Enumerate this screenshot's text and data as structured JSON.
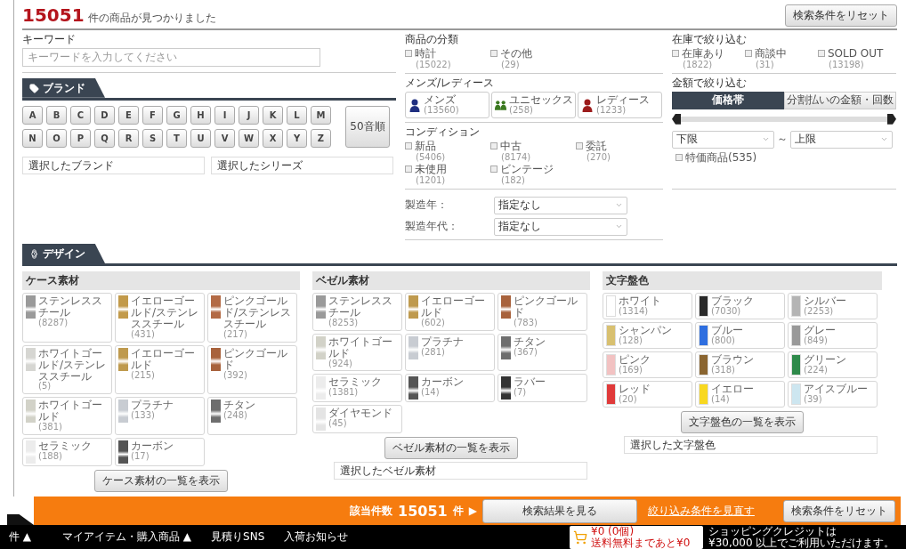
{
  "header": {
    "count": "15051",
    "text": "件の商品が見つかりました",
    "reset_button": "検索条件をリセット"
  },
  "keyword": {
    "label": "キーワード",
    "placeholder": "キーワードを入力してください"
  },
  "brand": {
    "tab": "ブランド",
    "letters": [
      "A",
      "B",
      "C",
      "D",
      "E",
      "F",
      "G",
      "H",
      "I",
      "J",
      "K",
      "L",
      "M",
      "N",
      "O",
      "P",
      "Q",
      "R",
      "S",
      "T",
      "U",
      "V",
      "W",
      "X",
      "Y",
      "Z"
    ],
    "kana_button": "50音順",
    "selected_brand": "選択したブランド",
    "selected_series": "選択したシリーズ"
  },
  "category": {
    "title": "商品の分類",
    "options": [
      {
        "label": "時計",
        "count": "(15022)",
        "checked": false
      },
      {
        "label": "その他",
        "count": "(29)",
        "checked": false
      }
    ]
  },
  "gender": {
    "title": "メンズ/レディース",
    "options": [
      {
        "label": "メンズ",
        "count": "(13560)",
        "color": "#1f2f80",
        "selected": false,
        "kind": "single"
      },
      {
        "label": "ユニセックス",
        "count": "(258)",
        "color": "#3d7a22",
        "selected": false,
        "kind": "pair"
      },
      {
        "label": "レディース",
        "count": "(1233)",
        "color": "#9c1c1c",
        "selected": false,
        "kind": "single"
      }
    ]
  },
  "condition": {
    "title": "コンディション",
    "options": [
      {
        "label": "新品",
        "count": "(5406)",
        "checked": false
      },
      {
        "label": "中古",
        "count": "(8174)",
        "checked": false
      },
      {
        "label": "委託",
        "count": "(270)",
        "checked": false
      },
      {
        "label": "未使用",
        "count": "(1201)",
        "checked": false
      },
      {
        "label": "ビンテージ",
        "count": "(182)",
        "checked": false
      }
    ]
  },
  "year_filters": [
    {
      "label": "製造年：",
      "value": "指定なし"
    },
    {
      "label": "製造年代：",
      "value": "指定なし"
    }
  ],
  "stock": {
    "title": "在庫で絞り込む",
    "options": [
      {
        "label": "在庫あり",
        "count": "(1822)",
        "checked": false
      },
      {
        "label": "商談中",
        "count": "(31)",
        "checked": false
      },
      {
        "label": "SOLD OUT",
        "count": "(13198)",
        "checked": false
      }
    ]
  },
  "price": {
    "title": "金額で絞り込む",
    "tabs": [
      {
        "label": "価格帯",
        "selected": true
      },
      {
        "label": "分割払いの金額・回数",
        "selected": false
      }
    ],
    "slider": {
      "handles": [
        {
          "level": 0
        },
        {
          "level": 1
        }
      ]
    },
    "min": "下限",
    "separator": "～",
    "max": "上限",
    "special": {
      "label": "特価商品(535)",
      "checked": false
    }
  },
  "design": {
    "tab": "デザイン",
    "groups": [
      {
        "title": "ケース素材",
        "kind": "material",
        "items": [
          {
            "label": "ステンレススチール",
            "count": "(8287)",
            "color": "#9a9a9a"
          },
          {
            "label": "イエローゴールド/ステンレススチール",
            "count": "(431)",
            "color": "#c29a4a"
          },
          {
            "label": "ピンクゴールド/ステンレススチール",
            "count": "(217)",
            "color": "#b36a45"
          },
          {
            "label": "ホワイトゴールド/ステンレススチール",
            "count": "(5)",
            "color": "#d6d6d2"
          },
          {
            "label": "イエローゴールド",
            "count": "(215)",
            "color": "#bf9a4e"
          },
          {
            "label": "ピンクゴールド",
            "count": "(392)",
            "color": "#a8623c"
          },
          {
            "label": "ホワイトゴールド",
            "count": "(381)",
            "color": "#d2d2c8"
          },
          {
            "label": "プラチナ",
            "count": "(133)",
            "color": "#c8ccd2"
          },
          {
            "label": "チタン",
            "count": "(248)",
            "color": "#6e6e6e"
          },
          {
            "label": "セラミック",
            "count": "(188)",
            "color": "#ececec"
          },
          {
            "label": "カーボン",
            "count": "(17)",
            "color": "#555555"
          }
        ],
        "list_button": "ケース素材の一覧を表示"
      },
      {
        "title": "ベゼル素材",
        "kind": "material",
        "items": [
          {
            "label": "ステンレススチール",
            "count": "(8253)",
            "color": "#9a9a9a"
          },
          {
            "label": "イエローゴールド",
            "count": "(602)",
            "color": "#bf9a4e"
          },
          {
            "label": "ピンクゴールド",
            "count": "(783)",
            "color": "#a8623c"
          },
          {
            "label": "ホワイトゴールド",
            "count": "(924)",
            "color": "#d2d2c8"
          },
          {
            "label": "プラチナ",
            "count": "(281)",
            "color": "#c8ccd2"
          },
          {
            "label": "チタン",
            "count": "(367)",
            "color": "#6e6e6e"
          },
          {
            "label": "セラミック",
            "count": "(1381)",
            "color": "#ececec"
          },
          {
            "label": "カーボン",
            "count": "(14)",
            "color": "#555555"
          },
          {
            "label": "ラバー",
            "count": "(7)",
            "color": "#333333"
          },
          {
            "label": "ダイヤモンド",
            "count": "(45)",
            "color": "#e4e4e4"
          }
        ],
        "list_button": "ベゼル素材の一覧を表示",
        "selection": "選択したベゼル素材"
      },
      {
        "title": "文字盤色",
        "kind": "solid",
        "items": [
          {
            "label": "ホワイト",
            "count": "(1314)",
            "color": "#ffffff"
          },
          {
            "label": "ブラック",
            "count": "(7030)",
            "color": "#2a2a2a"
          },
          {
            "label": "シルバー",
            "count": "(2253)",
            "color": "#b4b4b4"
          },
          {
            "label": "シャンパン",
            "count": "(128)",
            "color": "#d8c070"
          },
          {
            "label": "ブルー",
            "count": "(800)",
            "color": "#2f6fe0"
          },
          {
            "label": "グレー",
            "count": "(849)",
            "color": "#999999"
          },
          {
            "label": "ピンク",
            "count": "(169)",
            "color": "#f2c2c2"
          },
          {
            "label": "ブラウン",
            "count": "(318)",
            "color": "#8a6530"
          },
          {
            "label": "グリーン",
            "count": "(224)",
            "color": "#2e8a4a"
          },
          {
            "label": "レッド",
            "count": "(20)",
            "color": "#e03a3a"
          },
          {
            "label": "イエロー",
            "count": "(14)",
            "color": "#f8d820"
          },
          {
            "label": "アイスブルー",
            "count": "(39)",
            "color": "#cde6f0"
          }
        ],
        "list_button": "文字盤色の一覧を表示",
        "selection": "選択した文字盤色"
      }
    ]
  },
  "result_bar": {
    "label": "該当件数",
    "count": "15051",
    "unit": "件",
    "arrow": "▶",
    "results_button": "検索結果を見る",
    "review_link": "絞り込み条件を見直す",
    "reset_button": "検索条件をリセット"
  },
  "bottom_nav": {
    "items": [
      "件 ▲",
      "マイアイテム・購入商品 ▲",
      "見積りSNS",
      "入荷お知らせ"
    ],
    "cart": {
      "amount": "¥0 (0個)",
      "note": "送料無料まであと¥0"
    },
    "credit": [
      "ショッピングクレジットは",
      "¥30,000 以上でご利用いただけます。"
    ]
  }
}
